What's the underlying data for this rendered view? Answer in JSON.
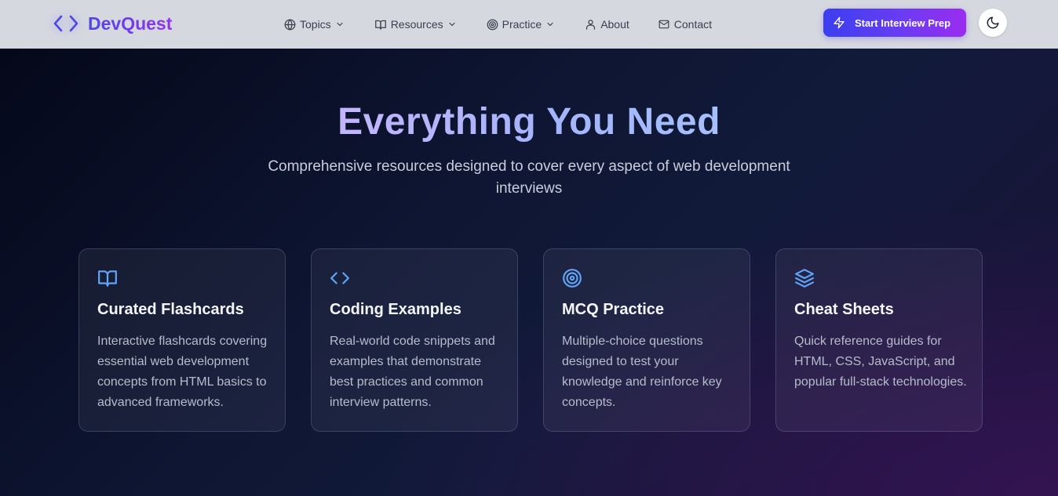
{
  "brand": {
    "name": "DevQuest",
    "icon": "code-brackets-icon"
  },
  "nav": {
    "items": [
      {
        "label": "Topics",
        "icon": "globe-icon",
        "dropdown": true
      },
      {
        "label": "Resources",
        "icon": "book-open-icon",
        "dropdown": true
      },
      {
        "label": "Practice",
        "icon": "target-icon",
        "dropdown": true
      },
      {
        "label": "About",
        "icon": "user-icon",
        "dropdown": false
      },
      {
        "label": "Contact",
        "icon": "mail-icon",
        "dropdown": false
      }
    ],
    "cta_label": "Start Interview Prep",
    "cta_icon": "lightning-icon",
    "theme_icon": "moon-icon"
  },
  "hero": {
    "title": "Everything You Need",
    "subtitle": "Comprehensive resources designed to cover every aspect of web development interviews"
  },
  "features": [
    {
      "icon": "book-open-icon",
      "title": "Curated Flashcards",
      "description": "Interactive flashcards covering essential web development concepts from HTML basics to advanced frameworks."
    },
    {
      "icon": "code-brackets-icon",
      "title": "Coding Examples",
      "description": "Real-world code snippets and examples that demonstrate best practices and common interview patterns."
    },
    {
      "icon": "target-icon",
      "title": "MCQ Practice",
      "description": "Multiple-choice questions designed to test your knowledge and reinforce key concepts."
    },
    {
      "icon": "layers-icon",
      "title": "Cheat Sheets",
      "description": "Quick reference guides for HTML, CSS, JavaScript, and popular full-stack technologies."
    }
  ],
  "colors": {
    "accent": "#4f46e5",
    "accent_secondary": "#9333ea",
    "icon_blue": "#60a5fa",
    "nav_bg": "#d6d8e0",
    "hero_bg": "#0e1633"
  }
}
